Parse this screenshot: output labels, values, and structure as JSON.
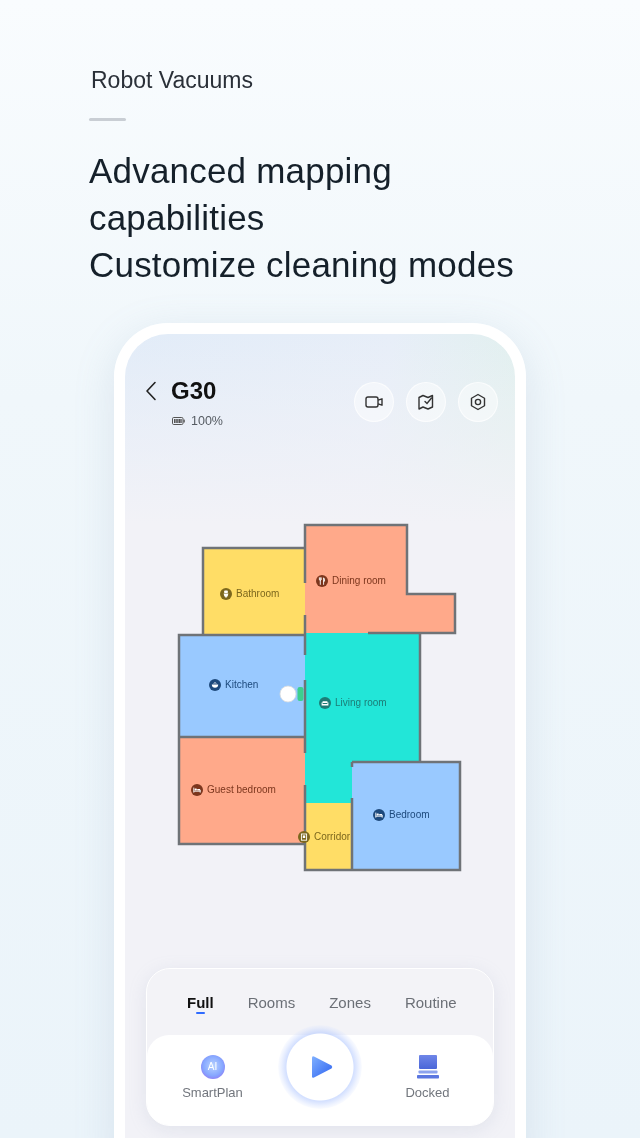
{
  "header": {
    "category": "Robot Vacuums",
    "headline": [
      "Advanced mapping capabilities",
      "Customize cleaning modes"
    ]
  },
  "device": {
    "name": "G30",
    "battery": "100%"
  },
  "map": {
    "rooms": [
      {
        "name": "Bathroom",
        "kind": "bathroom",
        "color": "#ffdd66"
      },
      {
        "name": "Dining room",
        "kind": "dining",
        "color": "#ffa98a"
      },
      {
        "name": "Kitchen",
        "kind": "kitchen",
        "color": "#99c9ff"
      },
      {
        "name": "Living room",
        "kind": "living",
        "color": "#22e6d8"
      },
      {
        "name": "Guest bedroom",
        "kind": "bedroom",
        "color": "#ffa98a"
      },
      {
        "name": "Corridor",
        "kind": "corridor",
        "color": "#ffdd66"
      },
      {
        "name": "Bedroom",
        "kind": "bedroom",
        "color": "#99c9ff"
      }
    ]
  },
  "modes": [
    {
      "label": "Full",
      "selected": true
    },
    {
      "label": "Rooms",
      "selected": false
    },
    {
      "label": "Zones",
      "selected": false
    },
    {
      "label": "Routine",
      "selected": false
    }
  ],
  "actions": {
    "smart_plan": {
      "badge": "AI",
      "label": "SmartPlan"
    },
    "status": {
      "label": "Docked"
    }
  }
}
